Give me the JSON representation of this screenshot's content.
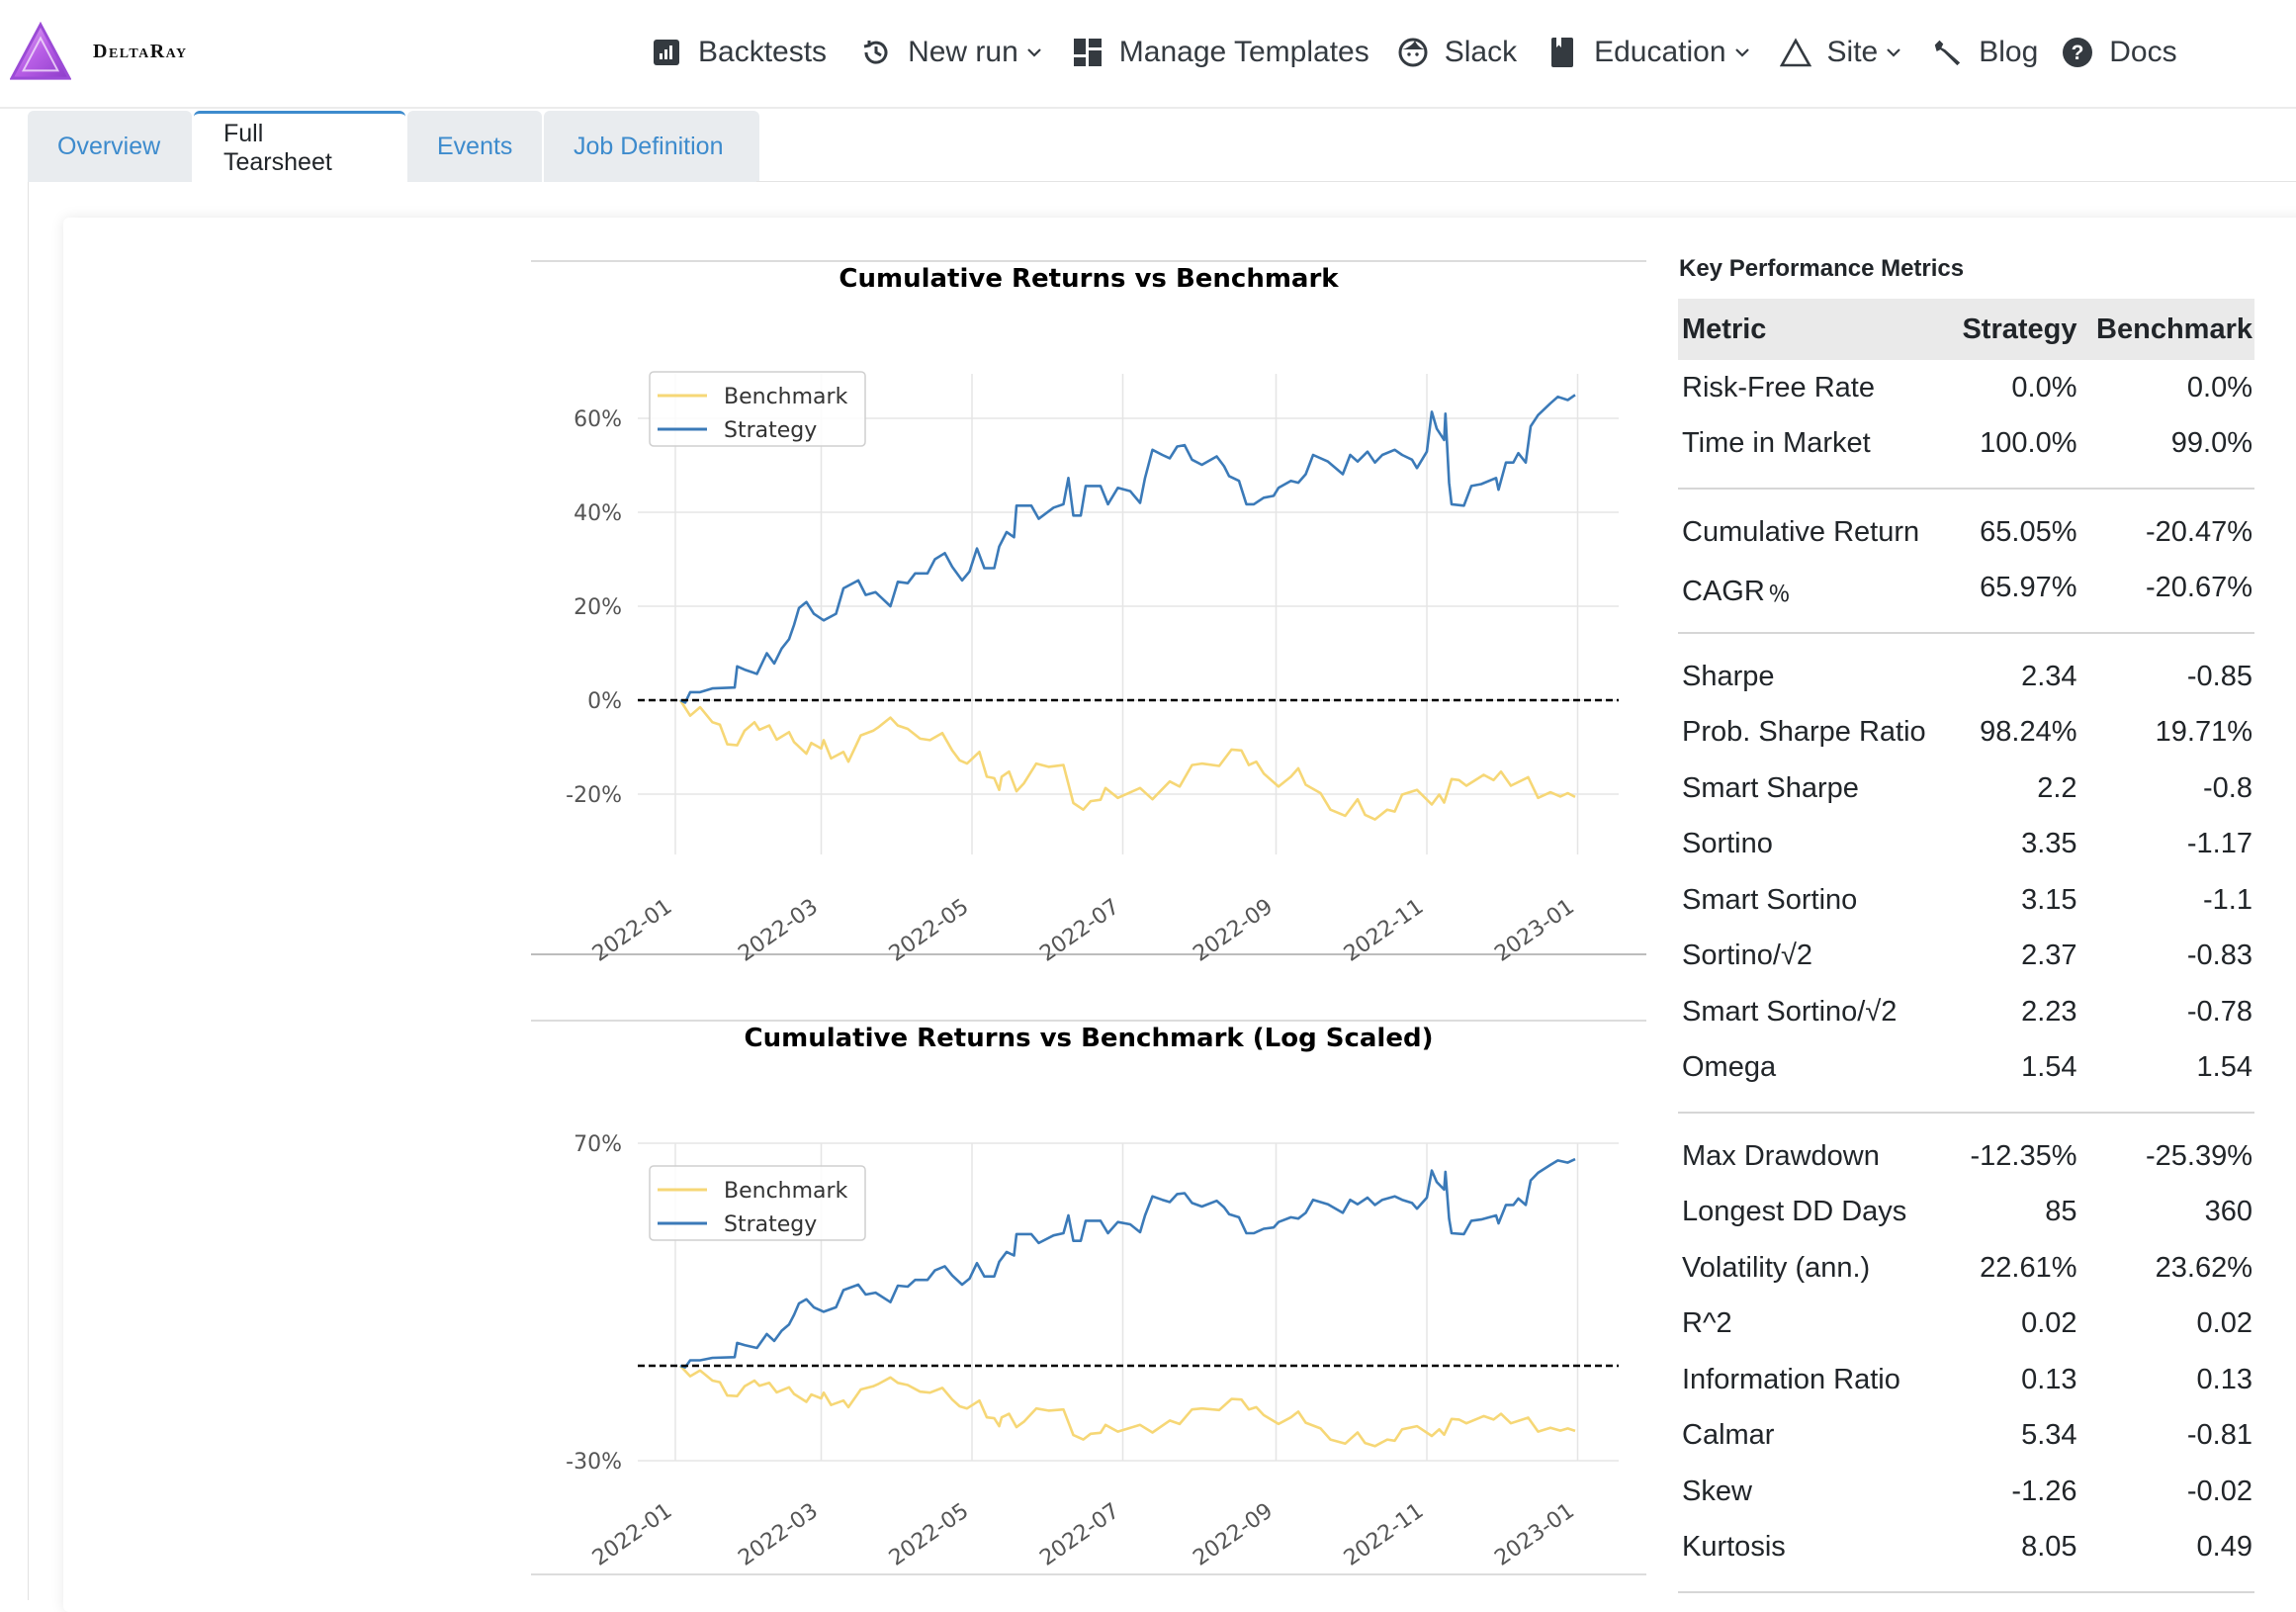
{
  "brand": {
    "name": "DeltaRay",
    "logo_icon": "triangle-logo-icon"
  },
  "nav": {
    "items": [
      {
        "label": "Backtests",
        "icon": "bar-chart-icon",
        "dropdown": false
      },
      {
        "label": "New run",
        "icon": "history-icon",
        "dropdown": true
      },
      {
        "label": "Manage Templates",
        "icon": "dashboard-icon",
        "dropdown": false
      },
      {
        "label": "Slack",
        "icon": "face-icon",
        "dropdown": false
      },
      {
        "label": "Education",
        "icon": "book-icon",
        "dropdown": true
      },
      {
        "label": "Site",
        "icon": "triangle-icon",
        "dropdown": true
      },
      {
        "label": "Blog",
        "icon": "wrench-icon",
        "dropdown": false
      },
      {
        "label": "Docs",
        "icon": "question-circle-icon",
        "dropdown": false
      }
    ]
  },
  "tabs": [
    {
      "label": "Overview",
      "active": false
    },
    {
      "label": "Full Tearsheet",
      "active": true
    },
    {
      "label": "Events",
      "active": false
    },
    {
      "label": "Job Definition",
      "active": false
    }
  ],
  "colors": {
    "accent": "#3d8bcd",
    "strategy": "#3b7ab8",
    "benchmark": "#f6d776",
    "grid": "#e5e5e5",
    "text_dark": "#212529"
  },
  "metrics": {
    "title": "Key Performance Metrics",
    "headers": [
      "Metric",
      "Strategy",
      "Benchmark"
    ],
    "groups": [
      [
        [
          "Risk-Free Rate",
          "0.0%",
          "0.0%"
        ],
        [
          "Time in Market",
          "100.0%",
          "99.0%"
        ]
      ],
      [
        [
          "Cumulative Return",
          "65.05%",
          "-20.47%"
        ],
        [
          "CAGR﹪",
          "65.97%",
          "-20.67%"
        ]
      ],
      [
        [
          "Sharpe",
          "2.34",
          "-0.85"
        ],
        [
          "Prob. Sharpe Ratio",
          "98.24%",
          "19.71%"
        ],
        [
          "Smart Sharpe",
          "2.2",
          "-0.8"
        ],
        [
          "Sortino",
          "3.35",
          "-1.17"
        ],
        [
          "Smart Sortino",
          "3.15",
          "-1.1"
        ],
        [
          "Sortino/√2",
          "2.37",
          "-0.83"
        ],
        [
          "Smart Sortino/√2",
          "2.23",
          "-0.78"
        ],
        [
          "Omega",
          "1.54",
          "1.54"
        ]
      ],
      [
        [
          "Max Drawdown",
          "-12.35%",
          "-25.39%"
        ],
        [
          "Longest DD Days",
          "85",
          "360"
        ],
        [
          "Volatility (ann.)",
          "22.61%",
          "23.62%"
        ],
        [
          "R^2",
          "0.02",
          "0.02"
        ],
        [
          "Information Ratio",
          "0.13",
          "0.13"
        ],
        [
          "Calmar",
          "5.34",
          "-0.81"
        ],
        [
          "Skew",
          "-1.26",
          "-0.02"
        ],
        [
          "Kurtosis",
          "8.05",
          "0.49"
        ]
      ]
    ]
  },
  "chart_data": [
    {
      "type": "line",
      "title": "Cumulative Returns vs Benchmark",
      "xlabel": "",
      "ylabel": "",
      "x_unit": "day of 2022 (0 = 2022-01-01)",
      "x_ticks": [
        0,
        59,
        120,
        181,
        243,
        304,
        365
      ],
      "x_tick_labels": [
        "2022-01",
        "2022-03",
        "2022-05",
        "2022-07",
        "2022-09",
        "2022-11",
        "2023-01"
      ],
      "y_scale": "linear",
      "y_ticks": [
        -20,
        0,
        20,
        40,
        60
      ],
      "y_tick_labels": [
        "-20%",
        "0%",
        "20%",
        "40%",
        "60%"
      ],
      "ylim": [
        -29,
        70
      ],
      "xlim": [
        -15,
        381
      ],
      "grid": true,
      "baseline": 0,
      "legend": {
        "position": "top-left",
        "entries": [
          "Benchmark",
          "Strategy"
        ]
      },
      "series_ref": "returns"
    },
    {
      "type": "line",
      "title": "Cumulative Returns vs Benchmark (Log Scaled)",
      "xlabel": "",
      "ylabel": "",
      "x_unit": "day of 2022 (0 = 2022-01-01)",
      "x_ticks": [
        0,
        59,
        120,
        181,
        243,
        304,
        365
      ],
      "x_tick_labels": [
        "2022-01",
        "2022-03",
        "2022-05",
        "2022-07",
        "2022-09",
        "2022-11",
        "2023-01"
      ],
      "y_scale": "symlog",
      "y_ticks": [
        -30,
        70
      ],
      "y_tick_labels": [
        "-30%",
        "70%"
      ],
      "ylim": [
        -30,
        70
      ],
      "xlim": [
        -15,
        381
      ],
      "grid": true,
      "baseline": 0,
      "legend": {
        "position": "top-left",
        "entries": [
          "Benchmark",
          "Strategy"
        ]
      },
      "series_ref": "returns"
    }
  ],
  "returns": {
    "series": [
      {
        "name": "Strategy",
        "color": "#3b7ab8",
        "points": [
          [
            2,
            0
          ],
          [
            4,
            -0.5
          ],
          [
            6,
            1.7
          ],
          [
            10,
            1.7
          ],
          [
            15,
            2.5
          ],
          [
            24,
            2.7
          ],
          [
            25,
            7.2
          ],
          [
            28,
            6.5
          ],
          [
            33,
            5.6
          ],
          [
            37,
            10
          ],
          [
            40,
            7.8
          ],
          [
            43,
            11
          ],
          [
            46,
            13
          ],
          [
            48,
            16
          ],
          [
            50,
            19.6
          ],
          [
            53,
            20.9
          ],
          [
            56,
            18.4
          ],
          [
            60,
            17
          ],
          [
            65,
            18.4
          ],
          [
            68,
            23.8
          ],
          [
            74,
            25.5
          ],
          [
            77,
            22.4
          ],
          [
            81,
            23
          ],
          [
            87,
            20
          ],
          [
            90,
            25.2
          ],
          [
            94,
            24.9
          ],
          [
            97,
            27
          ],
          [
            102,
            27
          ],
          [
            105,
            30
          ],
          [
            109,
            31.3
          ],
          [
            112,
            28.4
          ],
          [
            116,
            25.5
          ],
          [
            119,
            27.4
          ],
          [
            122,
            32.3
          ],
          [
            125,
            28.1
          ],
          [
            129,
            28.1
          ],
          [
            131,
            32.7
          ],
          [
            134,
            35.8
          ],
          [
            137,
            34.7
          ],
          [
            138,
            41.4
          ],
          [
            144,
            41.4
          ],
          [
            147,
            38.6
          ],
          [
            153,
            41
          ],
          [
            157,
            41.7
          ],
          [
            159,
            47.3
          ],
          [
            161,
            39.3
          ],
          [
            164,
            39.3
          ],
          [
            166,
            45.6
          ],
          [
            172,
            45.6
          ],
          [
            175,
            41.7
          ],
          [
            179,
            45.2
          ],
          [
            184,
            44.5
          ],
          [
            188,
            42
          ],
          [
            190,
            47.3
          ],
          [
            193,
            53.3
          ],
          [
            197,
            52.2
          ],
          [
            200,
            51.5
          ],
          [
            203,
            54
          ],
          [
            206,
            54.3
          ],
          [
            209,
            51.2
          ],
          [
            213,
            50.1
          ],
          [
            219,
            51.9
          ],
          [
            222,
            49.8
          ],
          [
            224,
            47.7
          ],
          [
            228,
            46.7
          ],
          [
            231,
            41.7
          ],
          [
            234,
            41.7
          ],
          [
            238,
            43.1
          ],
          [
            242,
            43.5
          ],
          [
            244,
            45.2
          ],
          [
            249,
            46.7
          ],
          [
            252,
            46.3
          ],
          [
            255,
            48.1
          ],
          [
            258,
            52.2
          ],
          [
            264,
            50.8
          ],
          [
            270,
            48.1
          ],
          [
            273,
            52.2
          ],
          [
            276,
            50.8
          ],
          [
            280,
            52.9
          ],
          [
            283,
            50.6
          ],
          [
            286,
            52.2
          ],
          [
            291,
            53.3
          ],
          [
            294,
            52.2
          ],
          [
            298,
            51.2
          ],
          [
            300,
            49.4
          ],
          [
            304,
            52.9
          ],
          [
            306,
            61.4
          ],
          [
            308,
            57.8
          ],
          [
            311,
            55.4
          ],
          [
            311.5,
            61
          ],
          [
            313,
            46.3
          ],
          [
            314,
            41.7
          ],
          [
            319,
            41.4
          ],
          [
            322,
            45.6
          ],
          [
            326,
            46
          ],
          [
            332,
            47.3
          ],
          [
            333,
            44.8
          ],
          [
            336,
            50.6
          ],
          [
            339,
            50.6
          ],
          [
            341,
            52.6
          ],
          [
            344,
            50.6
          ],
          [
            346,
            58.3
          ],
          [
            349,
            60.7
          ],
          [
            354,
            63.2
          ],
          [
            357,
            64.6
          ],
          [
            361,
            63.9
          ],
          [
            364,
            65
          ]
        ]
      },
      {
        "name": "Benchmark",
        "color": "#f6d776",
        "points": [
          [
            2,
            0
          ],
          [
            6,
            -3.3
          ],
          [
            10,
            -1.5
          ],
          [
            15,
            -4.7
          ],
          [
            18,
            -5.2
          ],
          [
            21,
            -9.4
          ],
          [
            25,
            -9.6
          ],
          [
            28,
            -6.5
          ],
          [
            32,
            -4.7
          ],
          [
            34,
            -6.3
          ],
          [
            38,
            -5.4
          ],
          [
            41,
            -8.4
          ],
          [
            46,
            -6.8
          ],
          [
            48,
            -8.9
          ],
          [
            53,
            -11.4
          ],
          [
            55,
            -9.1
          ],
          [
            59,
            -10.3
          ],
          [
            60,
            -8.5
          ],
          [
            63,
            -12.4
          ],
          [
            68,
            -11
          ],
          [
            70,
            -13.1
          ],
          [
            75,
            -7.5
          ],
          [
            80,
            -6.5
          ],
          [
            82,
            -5.8
          ],
          [
            87,
            -3.7
          ],
          [
            90,
            -5.4
          ],
          [
            94,
            -6.1
          ],
          [
            99,
            -8.2
          ],
          [
            103,
            -8.5
          ],
          [
            108,
            -7
          ],
          [
            112,
            -10.7
          ],
          [
            115,
            -12.8
          ],
          [
            118,
            -13.5
          ],
          [
            123,
            -11
          ],
          [
            126,
            -16.3
          ],
          [
            129,
            -16.6
          ],
          [
            131,
            -19.1
          ],
          [
            132,
            -16.3
          ],
          [
            135,
            -15.2
          ],
          [
            138,
            -19.4
          ],
          [
            141,
            -17.7
          ],
          [
            146,
            -13.5
          ],
          [
            151,
            -14.2
          ],
          [
            157,
            -13.8
          ],
          [
            161,
            -21.9
          ],
          [
            165,
            -23.3
          ],
          [
            168,
            -21.5
          ],
          [
            172,
            -21.2
          ],
          [
            174,
            -18.7
          ],
          [
            179,
            -20.8
          ],
          [
            188,
            -18.7
          ],
          [
            193,
            -21.1
          ],
          [
            200,
            -17.3
          ],
          [
            204,
            -18.4
          ],
          [
            209,
            -13.8
          ],
          [
            213,
            -13.5
          ],
          [
            220,
            -14
          ],
          [
            225,
            -10.5
          ],
          [
            229,
            -10.7
          ],
          [
            232,
            -13.8
          ],
          [
            235,
            -13.1
          ],
          [
            238,
            -15.6
          ],
          [
            244,
            -18.4
          ],
          [
            249,
            -16.3
          ],
          [
            252,
            -14.5
          ],
          [
            255,
            -18
          ],
          [
            261,
            -19.8
          ],
          [
            265,
            -23.3
          ],
          [
            271,
            -24.6
          ],
          [
            276,
            -21.1
          ],
          [
            279,
            -24.4
          ],
          [
            283,
            -25.4
          ],
          [
            288,
            -23.3
          ],
          [
            291,
            -23.7
          ],
          [
            294,
            -20.1
          ],
          [
            300,
            -19.1
          ],
          [
            306,
            -22.2
          ],
          [
            309,
            -20.1
          ],
          [
            311,
            -21.8
          ],
          [
            314,
            -16.8
          ],
          [
            317,
            -17
          ],
          [
            320,
            -18.2
          ],
          [
            327,
            -15.9
          ],
          [
            331,
            -17
          ],
          [
            334,
            -15.2
          ],
          [
            338,
            -18.2
          ],
          [
            345,
            -16.4
          ],
          [
            349,
            -20.8
          ],
          [
            354,
            -19.6
          ],
          [
            358,
            -20.5
          ],
          [
            361,
            -19.8
          ],
          [
            364,
            -20.6
          ]
        ]
      }
    ]
  }
}
